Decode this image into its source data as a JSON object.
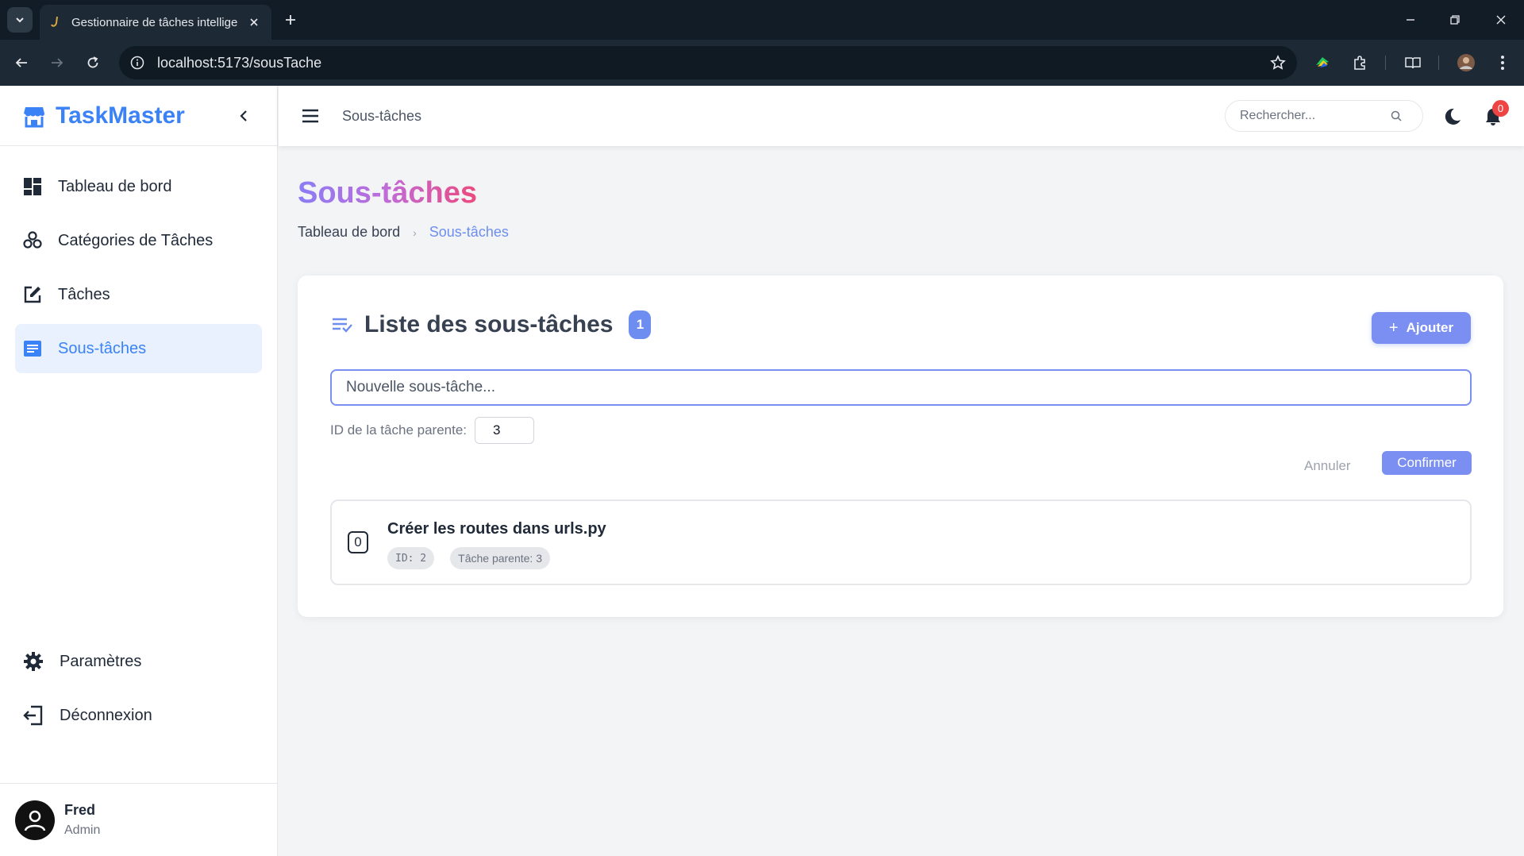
{
  "browser": {
    "tab_title": "Gestionnaire de tâches intelligent",
    "url": "localhost:5173/sousTache"
  },
  "sidebar": {
    "brand": "TaskMaster",
    "items": [
      {
        "label": "Tableau de bord",
        "icon": "dashboard-icon"
      },
      {
        "label": "Catégories de Tâches",
        "icon": "categories-icon"
      },
      {
        "label": "Tâches",
        "icon": "edit-task-icon"
      },
      {
        "label": "Sous-tâches",
        "icon": "subtask-icon",
        "active": true
      }
    ],
    "bottom_items": [
      {
        "label": "Paramètres",
        "icon": "gear-icon"
      },
      {
        "label": "Déconnexion",
        "icon": "logout-icon"
      }
    ],
    "user": {
      "name": "Fred",
      "role": "Admin"
    }
  },
  "header": {
    "title": "Sous-tâches",
    "search_placeholder": "Rechercher...",
    "notification_count": "0"
  },
  "main": {
    "title": "Sous-tâches",
    "breadcrumb": {
      "home": "Tableau de bord",
      "current": "Sous-tâches"
    },
    "card": {
      "title": "Liste des sous-tâches",
      "count": "1",
      "add_label": "Ajouter",
      "new_placeholder": "Nouvelle sous-tâche...",
      "parent_label": "ID de la tâche parente:",
      "parent_value": "3",
      "cancel_label": "Annuler",
      "confirm_label": "Confirmer",
      "items": [
        {
          "check": "0",
          "title": "Créer les routes dans urls.py",
          "id_tag": "ID: 2",
          "parent_tag": "Tâche parente: 3"
        }
      ]
    }
  },
  "colors": {
    "accent": "#3b82f6",
    "button": "#7b8ff2",
    "active_bg": "#e8f1fd",
    "badge_red": "#ef4444"
  }
}
